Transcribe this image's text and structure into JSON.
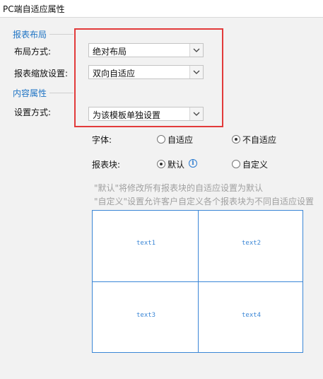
{
  "window": {
    "title": "PC端自适应属性"
  },
  "layout_section": {
    "title": "报表布局",
    "layout_mode": {
      "label": "布局方式:",
      "value": "绝对布局"
    },
    "scale_setting": {
      "label": "报表缩放设置:",
      "value": "双向自适应"
    }
  },
  "content_section": {
    "title": "内容属性",
    "setting_mode": {
      "label": "设置方式:",
      "value": "为该模板单独设置"
    },
    "font": {
      "label": "字体:",
      "options": [
        {
          "label": "自适应",
          "checked": false
        },
        {
          "label": "不自适应",
          "checked": true
        }
      ]
    },
    "block": {
      "label": "报表块:",
      "options": [
        {
          "label": "默认",
          "checked": true
        },
        {
          "label": "自定义",
          "checked": false
        }
      ]
    },
    "info_glyph": "i",
    "hints": [
      "\"默认\"将修改所有报表块的自适应设置为默认",
      "\"自定义\"设置允许客户自定义各个报表块为不同自适应设置"
    ],
    "preview_cells": [
      "text1",
      "text2",
      "text3",
      "text4"
    ]
  },
  "colors": {
    "accent": "#1f74c4",
    "highlight_border": "#e23a3a",
    "grid_line": "#3a86d6",
    "hint_text": "#a0a0a0"
  },
  "icons": {
    "dropdown": "chevron-down-icon",
    "info": "info-icon"
  }
}
